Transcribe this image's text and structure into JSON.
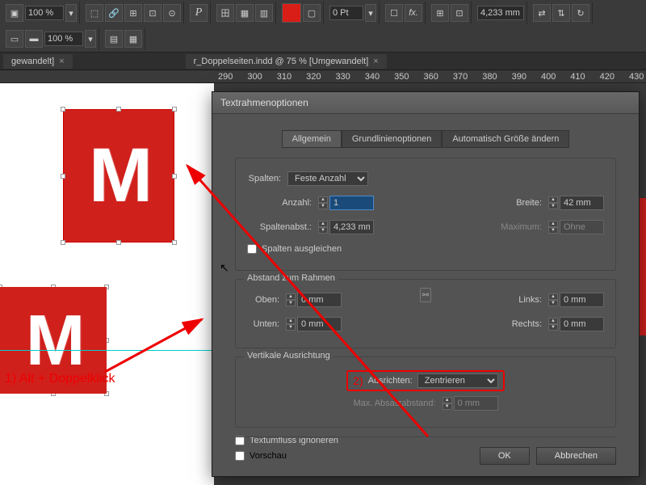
{
  "toolbar": {
    "zoom": "100 %",
    "stroke_width": "0 Pt",
    "opacity": "100 %",
    "measure": "4,233 mm"
  },
  "tabs": {
    "left_tab": "gewandelt]",
    "main_tab": "r_Doppelseiten.indd @ 75 % [Umgewandelt]"
  },
  "ruler": [
    "290",
    "300",
    "310",
    "320",
    "330",
    "340",
    "350",
    "360",
    "370",
    "380",
    "390",
    "400",
    "410",
    "420",
    "430"
  ],
  "annotation": {
    "step1": "1) Alt + Doppelklick",
    "step2": "2)"
  },
  "dialog": {
    "title": "Textrahmenoptionen",
    "tabs": {
      "general": "Allgemein",
      "baseline": "Grundlinienoptionen",
      "autosize": "Automatisch Größe ändern"
    },
    "columns": {
      "label": "Spalten:",
      "type": "Feste Anzahl",
      "count_label": "Anzahl:",
      "count_value": "1",
      "gutter_label": "Spaltenabst.:",
      "gutter_value": "4,233 mm",
      "width_label": "Breite:",
      "width_value": "42 mm",
      "max_label": "Maximum:",
      "max_value": "Ohne",
      "balance": "Spalten ausgleichen"
    },
    "inset": {
      "legend": "Abstand zum Rahmen",
      "top_label": "Oben:",
      "top_value": "0 mm",
      "bottom_label": "Unten:",
      "bottom_value": "0 mm",
      "left_label": "Links:",
      "left_value": "0 mm",
      "right_label": "Rechts:",
      "right_value": "0 mm"
    },
    "valign": {
      "legend": "Vertikale Ausrichtung",
      "align_label": "Ausrichten:",
      "align_value": "Zentrieren",
      "max_label": "Max. Absatzabstand:",
      "max_value": "0 mm"
    },
    "ignore_wrap": "Textumfluss ignorieren",
    "preview": "Vorschau",
    "ok": "OK",
    "cancel": "Abbrechen"
  }
}
